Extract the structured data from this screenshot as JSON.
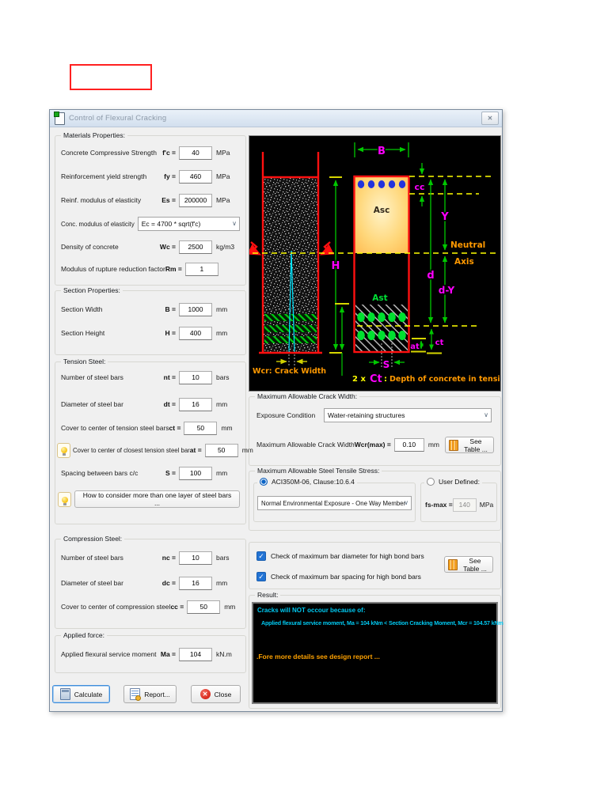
{
  "window": {
    "title": "Control of Flexural Cracking",
    "close_glyph": "✕"
  },
  "icons": {
    "check": "✓",
    "chevron": "∨"
  },
  "left": {
    "materials": {
      "title": "Materials Properties:",
      "rows": [
        {
          "label": "Concrete Compressive Strength",
          "sym": "f'c =",
          "value": "40",
          "unit": "MPa"
        },
        {
          "label": "Reinforcement yield strength",
          "sym": "fy =",
          "value": "460",
          "unit": "MPa"
        },
        {
          "label": "Reinf. modulus of elasticity",
          "sym": "Es =",
          "value": "200000",
          "unit": "MPa"
        }
      ],
      "ec": {
        "label": "Conc. modulus of elasticity",
        "value": "Ec = 4700 * sqrt(f'c)"
      },
      "rows2": [
        {
          "label": "Density of concrete",
          "sym": "Wc =",
          "value": "2500",
          "unit": "kg/m3"
        },
        {
          "label": "Modulus of rupture reduction factor",
          "sym": "Rm =",
          "value": "1",
          "unit": ""
        }
      ]
    },
    "section": {
      "title": "Section Properties:",
      "rows": [
        {
          "label": "Section Width",
          "sym": "B =",
          "value": "1000",
          "unit": "mm"
        },
        {
          "label": "Section Height",
          "sym": "H =",
          "value": "400",
          "unit": "mm"
        }
      ]
    },
    "tension": {
      "title": "Tension Steel:",
      "rows": [
        {
          "label": "Number of steel bars",
          "sym": "nt =",
          "value": "10",
          "unit": "bars"
        },
        {
          "label": "Diameter of steel bar",
          "sym": "dt =",
          "value": "16",
          "unit": "mm"
        },
        {
          "label": "Cover to center of tension steel bars",
          "sym": "ct =",
          "value": "50",
          "unit": "mm"
        },
        {
          "label": "Cover to center of closest tension steel bar",
          "sym": "at =",
          "value": "50",
          "unit": "mm"
        },
        {
          "label": "Spacing between bars c/c",
          "sym": "S =",
          "value": "100",
          "unit": "mm"
        }
      ],
      "how_button": "How to consider more than one layer of steel bars ..."
    },
    "compression": {
      "title": "Compression Steel:",
      "rows": [
        {
          "label": "Number of steel bars",
          "sym": "nc =",
          "value": "10",
          "unit": "bars"
        },
        {
          "label": "Diameter of steel bar",
          "sym": "dc =",
          "value": "16",
          "unit": "mm"
        },
        {
          "label": "Cover to center of compression steel",
          "sym": "cc =",
          "value": "50",
          "unit": "mm"
        }
      ]
    },
    "applied": {
      "title": "Applied force:",
      "rows": [
        {
          "label": "Applied flexural service moment",
          "sym": "Ma =",
          "value": "104",
          "unit": "kN.m"
        }
      ]
    },
    "buttons": {
      "calculate": "Calculate",
      "report": "Report...",
      "close": "Close"
    }
  },
  "right": {
    "crack": {
      "title": "Maximum Allowable Crack Width:",
      "exposure_label": "Exposure Condition",
      "exposure_value": "Water-retaining structures",
      "wcr_label": "Maximum Allowable Crack Width",
      "wcr_sym": "Wcr(max) =",
      "wcr_value": "0.10",
      "wcr_unit": "mm",
      "see_table": "See Table ..."
    },
    "stress": {
      "title": "Maximum Allowable Steel Tensile Stress:",
      "aci_label": "ACI350M-06, Clause:10.6.4",
      "aci_value": "Normal Environmental Exposure - One Way Member",
      "user_label": "User Defined:",
      "fs_sym": "fs-max =",
      "fs_value": "140",
      "fs_unit": "MPa"
    },
    "checks": {
      "check1": "Check of maximum bar diameter for high bond bars",
      "check2": "Check of maximum bar spacing for high bond bars",
      "see_table": "See Table ..."
    },
    "result": {
      "title": "Result:",
      "line1": "Cracks will NOT occour because of:",
      "line2": "Applied flexural service moment, Ma = 104 kNm < Section Cracking Moment, Mcr = 104.57 kNm",
      "line3": ".Fore more details see design report ..."
    }
  },
  "diagram": {
    "b": "B",
    "cc": "cc",
    "y": "Y",
    "h": "H",
    "d": "d",
    "dy": "d-Y",
    "at": "at",
    "ct": "ct",
    "s": "S",
    "asc": "Asc",
    "ast": "Ast",
    "neutral1": "Neutral",
    "neutral2": "Axis",
    "wcr_caption": "Wcr: Crack Width",
    "cap1": "2 x",
    "cap2": "Ct",
    "cap3": ":",
    "cap4": "Depth of concrete in tension zone"
  },
  "colors": {
    "accent": "#0b63c5",
    "magenta": "#ff00ff",
    "green": "#00c800",
    "yellow": "#ffff00",
    "orange": "#ff9900",
    "cyan": "#00c8f0",
    "red": "#ff1010"
  }
}
